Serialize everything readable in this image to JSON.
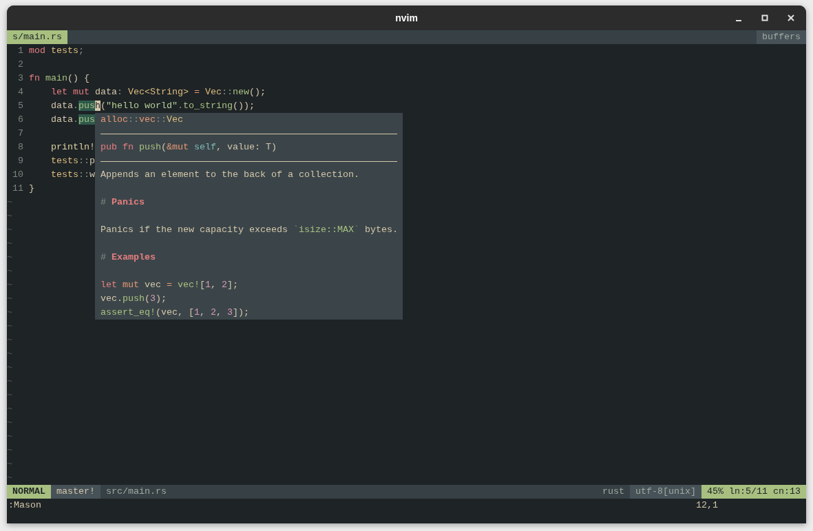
{
  "window": {
    "title": "nvim"
  },
  "tabline": {
    "tabs": [
      {
        "label": "s/main.rs",
        "selected": true
      }
    ],
    "right_label": "buffers"
  },
  "editor": {
    "lines": [
      {
        "number": "1",
        "tokens": [
          {
            "text": "mod",
            "kind": "kw"
          },
          {
            "text": " tests",
            "kind": "type"
          },
          {
            "text": ";",
            "kind": "punct"
          }
        ]
      },
      {
        "number": "2"
      },
      {
        "number": "3",
        "tokens": [
          {
            "text": "fn",
            "kind": "kw"
          },
          {
            "text": " main",
            "kind": "fn"
          },
          {
            "text": "() {",
            "kind": "plain"
          }
        ]
      },
      {
        "number": "4",
        "tokens": [
          {
            "text": "    let",
            "kind": "kw"
          },
          {
            "text": " mut",
            "kind": "kw"
          },
          {
            "text": " data",
            "kind": "plain"
          },
          {
            "text": ":",
            "kind": "punct"
          },
          {
            "text": " Vec<String>",
            "kind": "type"
          },
          {
            "text": " =",
            "kind": "op"
          },
          {
            "text": " Vec",
            "kind": "type"
          },
          {
            "text": "::",
            "kind": "punct"
          },
          {
            "text": "new",
            "kind": "fn"
          },
          {
            "text": "();",
            "kind": "plain"
          }
        ]
      },
      {
        "number": "5",
        "tokens": [
          {
            "text": "    data",
            "kind": "plain"
          },
          {
            "text": ".",
            "kind": "punct"
          },
          {
            "text": "pus",
            "kind": "ref"
          },
          {
            "text": "h",
            "kind": "cursor"
          },
          {
            "text": "(",
            "kind": "plain"
          },
          {
            "text": "\"hello world\"",
            "kind": "str"
          },
          {
            "text": ".",
            "kind": "punct"
          },
          {
            "text": "to_string",
            "kind": "fn"
          },
          {
            "text": "());",
            "kind": "plain"
          }
        ]
      },
      {
        "number": "6",
        "tokens": [
          {
            "text": "    data",
            "kind": "plain"
          },
          {
            "text": ".",
            "kind": "punct"
          },
          {
            "text": "pus",
            "kind": "ref"
          }
        ]
      },
      {
        "number": "7"
      },
      {
        "number": "8",
        "tokens": [
          {
            "text": "    println!",
            "kind": "macro"
          }
        ]
      },
      {
        "number": "9",
        "tokens": [
          {
            "text": "    tests",
            "kind": "type"
          },
          {
            "text": "::",
            "kind": "punct"
          },
          {
            "text": "p",
            "kind": "plain"
          }
        ]
      },
      {
        "number": "10",
        "tokens": [
          {
            "text": "    tests",
            "kind": "type"
          },
          {
            "text": "::",
            "kind": "punct"
          },
          {
            "text": "w",
            "kind": "plain"
          }
        ]
      },
      {
        "number": "11",
        "tokens": [
          {
            "text": "}",
            "kind": "plain"
          }
        ]
      }
    ],
    "filler_lines": [
      "~",
      "~",
      "~",
      "~",
      "~",
      "~",
      "~",
      "~",
      "~",
      "~",
      "~",
      "~",
      "~",
      "~",
      "~",
      "~",
      "~",
      "~",
      "~",
      "~",
      "~"
    ]
  },
  "hover_popup": {
    "lines": [
      {
        "kind": "text",
        "tokens": [
          {
            "text": "alloc",
            "kind": "mod"
          },
          {
            "text": "::",
            "kind": "punct"
          },
          {
            "text": "vec",
            "kind": "mod"
          },
          {
            "text": "::",
            "kind": "punct"
          },
          {
            "text": "Vec",
            "kind": "type"
          }
        ]
      },
      {
        "kind": "rule"
      },
      {
        "kind": "text",
        "tokens": [
          {
            "text": "pub",
            "kind": "kw"
          },
          {
            "text": " fn",
            "kind": "kw"
          },
          {
            "text": " push",
            "kind": "fn"
          },
          {
            "text": "(",
            "kind": "plain"
          },
          {
            "text": "&mut",
            "kind": "mod"
          },
          {
            "text": " self",
            "kind": "self"
          },
          {
            "text": ", value: T)",
            "kind": "plain"
          }
        ]
      },
      {
        "kind": "rule"
      },
      {
        "kind": "text",
        "tokens": [
          {
            "text": "Appends an element to the back of a collection.",
            "kind": "plain"
          }
        ]
      },
      {
        "kind": "blank"
      },
      {
        "kind": "text",
        "tokens": [
          {
            "text": "#",
            "kind": "punct"
          },
          {
            "text": " Panics",
            "kind": "heading"
          }
        ]
      },
      {
        "kind": "blank"
      },
      {
        "kind": "text",
        "tokens": [
          {
            "text": "Panics if the new capacity exceeds",
            "kind": "plain"
          },
          {
            "text": " `",
            "kind": "punct"
          },
          {
            "text": "isize::MAX",
            "kind": "fn"
          },
          {
            "text": "`",
            "kind": "punct"
          },
          {
            "text": " bytes.",
            "kind": "plain"
          }
        ]
      },
      {
        "kind": "blank"
      },
      {
        "kind": "text",
        "tokens": [
          {
            "text": "#",
            "kind": "punct"
          },
          {
            "text": " Examples",
            "kind": "heading"
          }
        ]
      },
      {
        "kind": "blank"
      },
      {
        "kind": "text",
        "tokens": [
          {
            "text": "let",
            "kind": "kw"
          },
          {
            "text": " mut",
            "kind": "mod"
          },
          {
            "text": " vec",
            "kind": "plain"
          },
          {
            "text": " =",
            "kind": "mod"
          },
          {
            "text": " vec!",
            "kind": "fn"
          },
          {
            "text": "[",
            "kind": "plain"
          },
          {
            "text": "1",
            "kind": "num"
          },
          {
            "text": ", ",
            "kind": "plain"
          },
          {
            "text": "2",
            "kind": "num"
          },
          {
            "text": "];",
            "kind": "plain"
          }
        ]
      },
      {
        "kind": "text",
        "tokens": [
          {
            "text": "vec.",
            "kind": "plain"
          },
          {
            "text": "push",
            "kind": "fn"
          },
          {
            "text": "(",
            "kind": "plain"
          },
          {
            "text": "3",
            "kind": "num"
          },
          {
            "text": ");",
            "kind": "plain"
          }
        ]
      },
      {
        "kind": "text",
        "tokens": [
          {
            "text": "assert_eq!",
            "kind": "fn"
          },
          {
            "text": "(vec, [",
            "kind": "plain"
          },
          {
            "text": "1",
            "kind": "num"
          },
          {
            "text": ", ",
            "kind": "plain"
          },
          {
            "text": "2",
            "kind": "num"
          },
          {
            "text": ", ",
            "kind": "plain"
          },
          {
            "text": "3",
            "kind": "num"
          },
          {
            "text": "]);",
            "kind": "plain"
          }
        ]
      }
    ]
  },
  "status_line": {
    "mode": "NORMAL",
    "branch": "master!",
    "file": "src/main.rs",
    "filetype": "rust",
    "encoding": "utf-8[unix]",
    "position": "45% ln:5/11 cn:13"
  },
  "command_line": {
    "text": ":Mason",
    "ruler": "12,1"
  }
}
